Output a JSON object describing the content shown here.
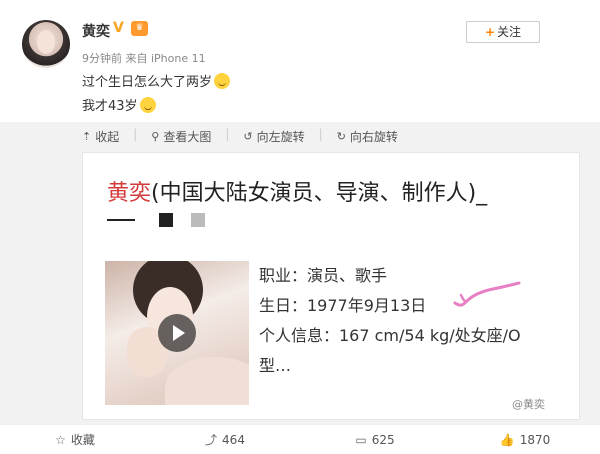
{
  "post": {
    "username": "黄奕",
    "verified_icon": "v-verified-icon",
    "vip_icon": "vip-icon",
    "meta": "9分钟前 来自 iPhone 11",
    "follow_label": "关注",
    "text_line1": "过个生日怎么大了两岁",
    "text_line2": "我才43岁"
  },
  "image_toolbar": {
    "collect": "收起",
    "view_large": "查看大图",
    "rotate_left": "向左旋转",
    "rotate_right": "向右旋转"
  },
  "card": {
    "title_name": "黄奕",
    "title_rest": "(中国大陆女演员、导演、制作人)_",
    "occupation": "职业：演员、歌手",
    "birthday": "生日：1977年9月13日",
    "info": "个人信息：167 cm/54 kg/处女座/O",
    "info_cont": "型…"
  },
  "watermark": "@黄奕",
  "actions": {
    "favorite": "收藏",
    "forward": "464",
    "comment": "625",
    "like": "1870"
  },
  "colors": {
    "accent_orange": "#ff8200",
    "title_red": "#d43a3a",
    "squiggle_pink": "#e87fc4"
  }
}
